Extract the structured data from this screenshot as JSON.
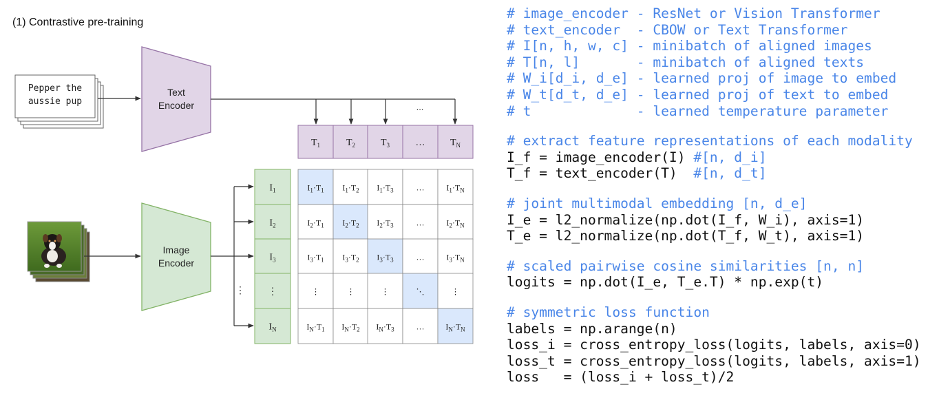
{
  "title": "(1) Contrastive pre-training",
  "text_input": {
    "line1": "Pepper the",
    "line2": "aussie pup"
  },
  "text_encoder": {
    "line1": "Text",
    "line2": "Encoder"
  },
  "image_encoder": {
    "line1": "Image",
    "line2": "Encoder"
  },
  "text_features": [
    {
      "base": "T",
      "sub": "1"
    },
    {
      "base": "T",
      "sub": "2"
    },
    {
      "base": "T",
      "sub": "3"
    },
    {
      "base": "…",
      "sub": ""
    },
    {
      "base": "T",
      "sub": "N"
    }
  ],
  "image_features": [
    {
      "base": "I",
      "sub": "1"
    },
    {
      "base": "I",
      "sub": "2"
    },
    {
      "base": "I",
      "sub": "3"
    },
    {
      "base": "⋮",
      "sub": ""
    },
    {
      "base": "I",
      "sub": "N"
    }
  ],
  "matrix": [
    [
      [
        "I",
        "1",
        "T",
        "1"
      ],
      [
        "I",
        "1",
        "T",
        "2"
      ],
      [
        "I",
        "1",
        "T",
        "3"
      ],
      [
        "…"
      ],
      [
        "I",
        "1",
        "T",
        "N"
      ]
    ],
    [
      [
        "I",
        "2",
        "T",
        "1"
      ],
      [
        "I",
        "2",
        "T",
        "2"
      ],
      [
        "I",
        "2",
        "T",
        "3"
      ],
      [
        "…"
      ],
      [
        "I",
        "2",
        "T",
        "N"
      ]
    ],
    [
      [
        "I",
        "3",
        "T",
        "1"
      ],
      [
        "I",
        "3",
        "T",
        "2"
      ],
      [
        "I",
        "3",
        "T",
        "3"
      ],
      [
        "…"
      ],
      [
        "I",
        "3",
        "T",
        "N"
      ]
    ],
    [
      [
        "⋮"
      ],
      [
        "⋮"
      ],
      [
        "⋮"
      ],
      [
        "⋱"
      ],
      [
        "⋮"
      ]
    ],
    [
      [
        "I",
        "N",
        "T",
        "1"
      ],
      [
        "I",
        "N",
        "T",
        "2"
      ],
      [
        "I",
        "N",
        "T",
        "3"
      ],
      [
        "…"
      ],
      [
        "I",
        "N",
        "T",
        "N"
      ]
    ]
  ],
  "arrow_ellipsis": "...",
  "side_ellipsis": "⋮",
  "colors": {
    "encoder_text_fill": "#e1d5e7",
    "encoder_text_stroke": "#9673a6",
    "encoder_image_fill": "#d5e8d4",
    "encoder_image_stroke": "#82b366",
    "diagonal_fill": "#dae8fc",
    "code_comment": "#4a86e8"
  },
  "code": [
    {
      "type": "comment",
      "text": "# image_encoder - ResNet or Vision Transformer"
    },
    {
      "type": "comment",
      "text": "# text_encoder  - CBOW or Text Transformer"
    },
    {
      "type": "comment",
      "text": "# I[n, h, w, c] - minibatch of aligned images"
    },
    {
      "type": "comment",
      "text": "# T[n, l]       - minibatch of aligned texts"
    },
    {
      "type": "comment",
      "text": "# W_i[d_i, d_e] - learned proj of image to embed"
    },
    {
      "type": "comment",
      "text": "# W_t[d_t, d_e] - learned proj of text to embed"
    },
    {
      "type": "comment",
      "text": "# t             - learned temperature parameter"
    },
    {
      "type": "blank",
      "text": ""
    },
    {
      "type": "comment",
      "text": "# extract feature representations of each modality"
    },
    {
      "type": "mixed",
      "text": "I_f = image_encoder(I) ",
      "comment": "#[n, d_i]"
    },
    {
      "type": "mixed",
      "text": "T_f = text_encoder(T)  ",
      "comment": "#[n, d_t]"
    },
    {
      "type": "blank",
      "text": ""
    },
    {
      "type": "comment",
      "text": "# joint multimodal embedding [n, d_e]"
    },
    {
      "type": "code",
      "text": "I_e = l2_normalize(np.dot(I_f, W_i), axis=1)"
    },
    {
      "type": "code",
      "text": "T_e = l2_normalize(np.dot(T_f, W_t), axis=1)"
    },
    {
      "type": "blank",
      "text": ""
    },
    {
      "type": "comment",
      "text": "# scaled pairwise cosine similarities [n, n]"
    },
    {
      "type": "code",
      "text": "logits = np.dot(I_e, T_e.T) * np.exp(t)"
    },
    {
      "type": "blank",
      "text": ""
    },
    {
      "type": "comment",
      "text": "# symmetric loss function"
    },
    {
      "type": "code",
      "text": "labels = np.arange(n)"
    },
    {
      "type": "code",
      "text": "loss_i = cross_entropy_loss(logits, labels, axis=0)"
    },
    {
      "type": "code",
      "text": "loss_t = cross_entropy_loss(logits, labels, axis=1)"
    },
    {
      "type": "code",
      "text": "loss   = (loss_i + loss_t)/2"
    }
  ]
}
